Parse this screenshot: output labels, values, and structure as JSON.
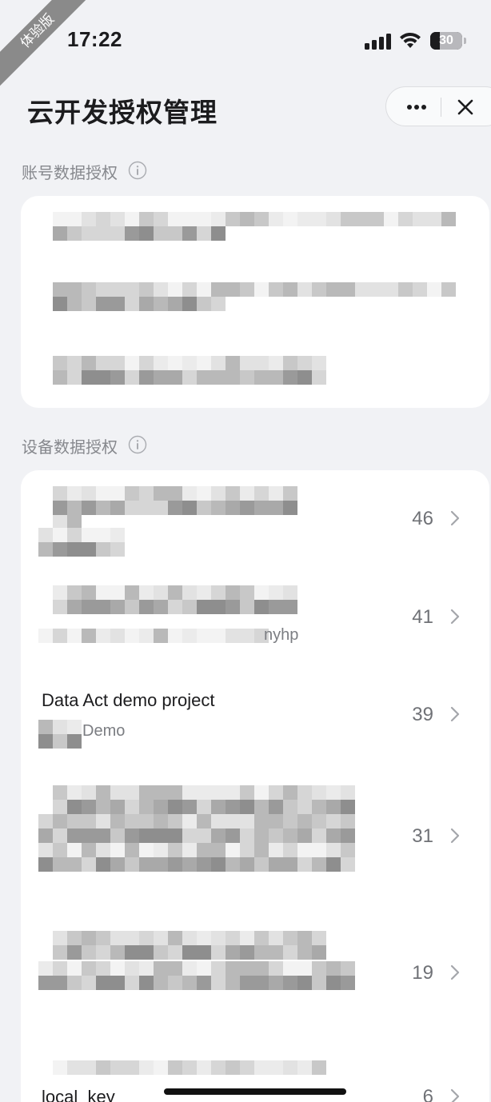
{
  "trial_badge": "体验版",
  "status_bar": {
    "time": "17:22",
    "battery_level": "30",
    "icons": [
      "cellular-signal-icon",
      "wifi-icon",
      "battery-icon"
    ]
  },
  "nav": {
    "title": "云开发授权管理",
    "more_icon": "more-dots-icon",
    "close_icon": "close-icon"
  },
  "account_section": {
    "label": "账号数据授权",
    "icon": "info-icon",
    "items": [
      "[redacted]",
      "[redacted]",
      "[redacted]"
    ]
  },
  "device_section": {
    "label": "设备数据授权",
    "icon": "info-icon",
    "items": [
      {
        "title": "[redacted]",
        "subtitle": "",
        "count": "46"
      },
      {
        "title": "[redacted]",
        "subtitle": "nyhp",
        "count": "41"
      },
      {
        "title": "Data Act demo project",
        "subtitle": "Demo",
        "count": "39"
      },
      {
        "title": "[redacted]",
        "subtitle": "",
        "count": "31"
      },
      {
        "title": "[redacted]",
        "subtitle": "",
        "count": "19"
      },
      {
        "title": "local_key",
        "subtitle": "",
        "count": "6"
      }
    ]
  },
  "colors": {
    "background": "#f1f2f5",
    "card": "#ffffff",
    "primary_text": "#1c1c1e",
    "secondary_text": "#86888d"
  }
}
